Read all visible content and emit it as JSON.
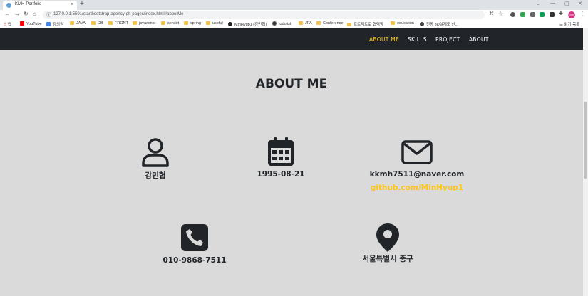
{
  "browser": {
    "tab_title": "KMH-Portfolio",
    "url": "127.0.0.1:5501/startbootstrap-agency-gh-pages/index.html#aboutMe",
    "profile_label": "KMH",
    "bookmarks": [
      "앱",
      "YouTube",
      "강의원",
      "JAVA",
      "DB",
      "FRONT",
      "javascript",
      "servlet",
      "spring",
      "useful",
      "MinHyup1 (강민협)",
      "todolist",
      "JPA",
      "Conference",
      "프로젝트로 협력학",
      "education",
      "전공 3D설계도 신..."
    ],
    "reading_list": "읽기 목록"
  },
  "nav": {
    "links": [
      "ABOUT ME",
      "SKILLS",
      "PROJECT",
      "ABOUT"
    ],
    "active_color": "#fec810"
  },
  "about": {
    "title": "ABOUT ME",
    "name": "강민협",
    "birthday": "1995-08-21",
    "email": "kkmh7511@naver.com",
    "github": "github.com/MinHyup1",
    "phone": "010-9868-7511",
    "location": "서울특별시 중구"
  },
  "icons": [
    "user-icon",
    "calendar-icon",
    "envelope-icon",
    "phone-icon",
    "map-marker-icon"
  ]
}
